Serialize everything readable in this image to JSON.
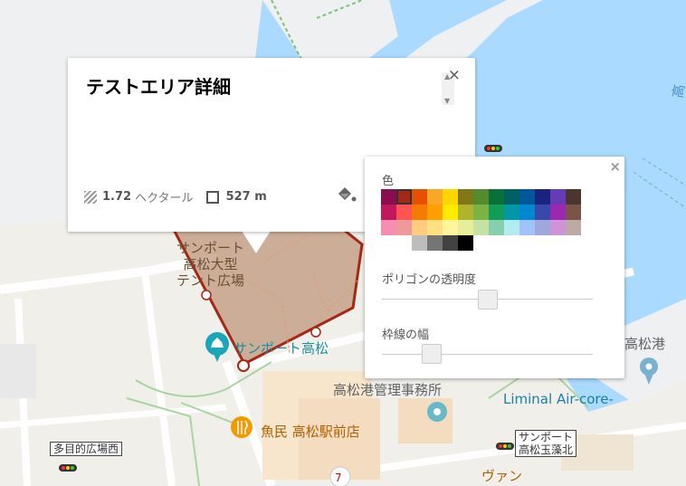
{
  "info_window": {
    "title": "テストエリア詳細",
    "area_value": "1.72",
    "area_unit": "ヘクタール",
    "perimeter_value": "527 m",
    "close_symbol": "×"
  },
  "style_panel": {
    "close_symbol": "×",
    "color_label": "色",
    "opacity_label": "ポリゴンの透明度",
    "stroke_width_label": "枠線の幅",
    "opacity_level_fraction": 0.5,
    "stroke_width_level_fraction": 0.21,
    "selected_color": "#a52714",
    "palette": [
      [
        "#880e4f",
        "#a52714",
        "#e65100",
        "#f9a825",
        "#ffd600",
        "#817717",
        "#558b2f",
        "#097138",
        "#006064",
        "#01579b",
        "#1a237e",
        "#673ab7",
        "#4e342e"
      ],
      [
        "#c2185b",
        "#ff5252",
        "#f57c00",
        "#ffa000",
        "#ffea00",
        "#afb42b",
        "#7cb342",
        "#0f9d58",
        "#0097a7",
        "#0288d1",
        "#3949ab",
        "#9c27b0",
        "#795548"
      ],
      [
        "#f48fb1",
        "#ef9a9a",
        "#ffcc80",
        "#ffe082",
        "#fff59d",
        "#e6ee9c",
        "#c5e1a5",
        "#87ceac",
        "#b2ebf2",
        "#9fc3f8",
        "#9fa8da",
        "#ce93d8",
        "#bcaaa4"
      ],
      [
        "#ffffff",
        "#bdbdbd",
        "#757575",
        "#424242",
        "#000000"
      ]
    ]
  },
  "map_labels": {
    "park_name": "サンポート\n高松大型\nテント広場",
    "sunport": "サンポート高松",
    "port_office": "高松港管理事務所",
    "liminal": "Liminal Air-core-",
    "uomin": "魚民 高松駅前店",
    "takamatsu_port": "高松港",
    "tamamo": "サンポート\n高松玉藻北",
    "tamokuteki": "多目的広場西",
    "van": "ヴァン",
    "edge_kanji": "高"
  }
}
